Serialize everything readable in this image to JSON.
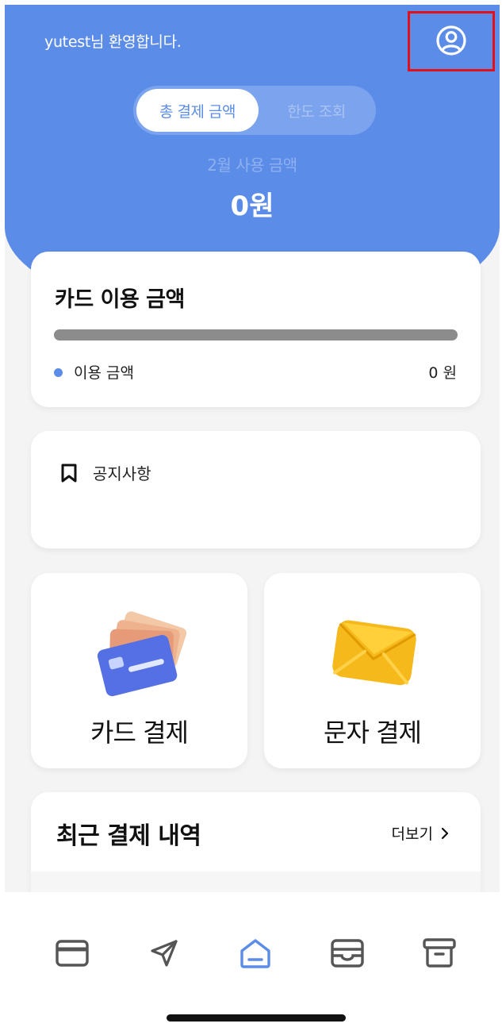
{
  "header": {
    "welcome": "yutest님 환영합니다.",
    "profile_icon": "user-circle-icon"
  },
  "segment": {
    "tabs": [
      {
        "label": "총 결제 금액",
        "active": true
      },
      {
        "label": "한도 조회",
        "active": false
      }
    ]
  },
  "summary": {
    "month_label": "2월 사용 금액",
    "total": "0원"
  },
  "usage_card": {
    "title": "카드 이용 금액",
    "progress": 0,
    "legend_label": "이용 금액",
    "legend_value": "0 원"
  },
  "notice": {
    "label": "공지사항",
    "icon": "bookmark-icon"
  },
  "tiles": [
    {
      "label": "카드 결제",
      "icon": "credit-cards-icon"
    },
    {
      "label": "문자 결제",
      "icon": "envelope-icon"
    }
  ],
  "recent": {
    "title": "최근 결제 내역",
    "more_label": "더보기"
  },
  "tabbar": {
    "items": [
      {
        "icon": "card-icon",
        "active": false
      },
      {
        "icon": "send-icon",
        "active": false
      },
      {
        "icon": "home-icon",
        "active": true
      },
      {
        "icon": "wallet-icon",
        "active": false
      },
      {
        "icon": "archive-icon",
        "active": false
      }
    ]
  },
  "colors": {
    "accent": "#5b8ce8",
    "highlight": "#e3101a",
    "icon_gray": "#555555"
  }
}
